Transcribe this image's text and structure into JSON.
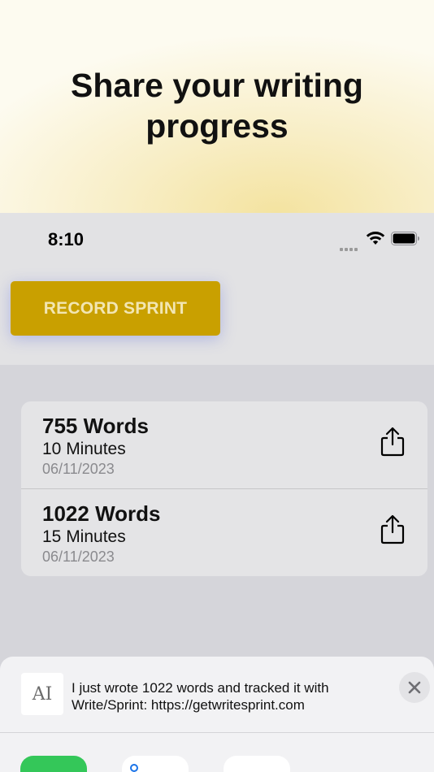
{
  "hero": {
    "title": "Share your writing progress"
  },
  "status_bar": {
    "time": "8:10",
    "icons": [
      "cellular-signal-icon",
      "wifi-icon",
      "battery-icon"
    ]
  },
  "record_button": {
    "label": "RECORD SPRINT",
    "color": "#c9a000"
  },
  "sprints": [
    {
      "words": "755 Words",
      "minutes": "10 Minutes",
      "date": "06/11/2023",
      "icon": "share-icon"
    },
    {
      "words": "1022 Words",
      "minutes": "15 Minutes",
      "date": "06/11/2023",
      "icon": "share-icon"
    }
  ],
  "share_sheet": {
    "preview_thumb": "AI",
    "preview_text": "I just wrote 1022 words and tracked it with Write/Sprint: https://getwritesprint.com",
    "close_icon": "close-icon",
    "apps": [
      "messages-app-icon",
      "app-icon",
      "app-icon"
    ]
  }
}
